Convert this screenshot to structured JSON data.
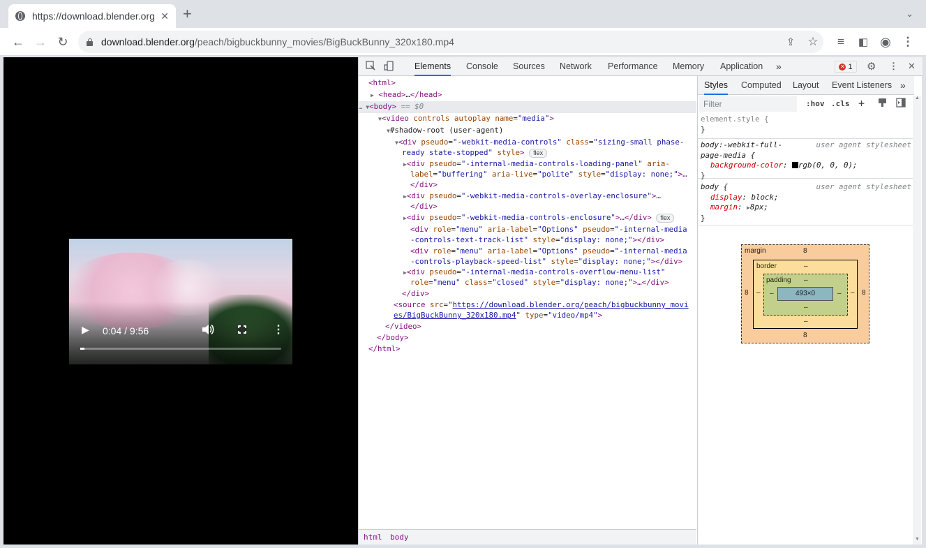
{
  "browser": {
    "tab_title": "https://download.blender.org/peach/bigbuckbunny_movies/BigBuckBunny_320x180.mp4",
    "url_domain": "download.blender.org",
    "url_path": "/peach/bigbuckbunny_movies/BigBuckBunny_320x180.mp4",
    "new_tab_glyph": "+",
    "close_glyph": "✕",
    "back_glyph": "←",
    "forward_glyph": "→",
    "reload_glyph": "↻",
    "tab_search_glyph": "⌄",
    "lock_glyph": "🔒",
    "share_glyph": "⇪",
    "star_glyph": "☆",
    "reading_list_glyph": "≡",
    "sidepanel_glyph": "◧",
    "profile_glyph": "◉",
    "menu_glyph": "⋮"
  },
  "video": {
    "play_glyph": "▶",
    "time": "0:04 / 9:56",
    "volume_glyph": "🔊",
    "more_glyph": "⋮",
    "progress": 0.022
  },
  "devtools": {
    "tabs": [
      "Elements",
      "Console",
      "Sources",
      "Network",
      "Performance",
      "Memory",
      "Application"
    ],
    "more_tabs_glyph": "»",
    "error_count": "1",
    "error_glyph": "✕",
    "inspect_glyph": "⬚",
    "device_glyph": "▯",
    "settings_glyph": "⚙",
    "kebab_glyph": "⋮",
    "close_glyph": "✕",
    "flex_badge": "flex",
    "dom": {
      "l1": "<html>",
      "l2_open": "<head>",
      "l2_dots": "…",
      "l2_close": "</head>",
      "l3_dots": "…",
      "l3_tag": "<body>",
      "l3_eq": " == $0",
      "l4_tag": "<video ",
      "l4_attrs": "controls autoplay name",
      "l4_eq": "=",
      "l4_val": "\"media\"",
      "l4_end": ">",
      "l5": "#shadow-root (user-agent)",
      "l6_tag": "<div ",
      "l6_an1": "pseudo",
      "l6_av1": "\"-webkit-media-controls\"",
      "l6_an2": " class",
      "l6_av2a": "\"sizing-small phase-",
      "l6_av2b": "ready state-stopped\"",
      "l6_an3": " style",
      "l7_tag": "<div ",
      "l7_an1": "pseudo",
      "l7_av1": "\"-internal-media-controls-loading-panel\"",
      "l7_an2": " aria-",
      "l7_an2b": "label",
      "l7_av2": "\"buffering\"",
      "l7_an3": " aria-live",
      "l7_av3": "\"polite\"",
      "l7_an4": " style",
      "l7_av4": "\"display: none;\"",
      "l7_end": ">…",
      "close_div": "</div>",
      "l8_tag": "<div ",
      "l8_an": "pseudo",
      "l8_av": "\"-webkit-media-controls-overlay-enclosure\"",
      "l8_end": ">…",
      "l9_tag": "<div ",
      "l9_an": "pseudo",
      "l9_av": "\"-webkit-media-controls-enclosure\"",
      "l9_end": ">…</div>",
      "l10_tag": "<div ",
      "l10_an1": "role",
      "l10_av1": "\"menu\"",
      "l10_an2": " aria-label",
      "l10_av2": "\"Options\"",
      "l10_an3": " pseudo",
      "l10_av3a": "\"-internal-media",
      "l10_av3b": "-controls-text-track-list\"",
      "l10_an4": " style",
      "l10_av4": "\"display: none;\"",
      "l10_end": "></div>",
      "l11_av3b": "-controls-playback-speed-list\"",
      "l12_av": "\"-internal-media-controls-overflow-menu-list\"",
      "l12_an2": " class",
      "l12_av2": "\"closed\"",
      "l12_end": ">…</div>",
      "l13_tag": "<source ",
      "l13_an": "src",
      "l13_eq": "=\"",
      "l13_link_a": "https://download.blender.org/peach/bigbuckbunny_movi",
      "l13_link_b": "es/BigBuckBunny_320x180.mp4",
      "l13_q": "\"",
      "l13_an2": " type",
      "l13_av2": "\"video/mp4\"",
      "l13_end": ">",
      "l14": "</video>",
      "l15": "</body>",
      "l16": "</html>"
    },
    "breadcrumbs": [
      "html",
      "body"
    ],
    "styles": {
      "tabs": [
        "Styles",
        "Computed",
        "Layout",
        "Event Listeners"
      ],
      "more_glyph": "»",
      "filter_placeholder": "Filter",
      "hov": ":hov",
      "cls": ".cls",
      "plus": "+",
      "rule1_selector": "element.style {",
      "rule_close": "}",
      "rule2_selector_a": "body:-webkit-full-",
      "rule2_selector_b": "page-media {",
      "rule2_source": "user agent stylesheet",
      "rule2_prop": "background-color",
      "rule2_val": "rgb(0, 0, 0);",
      "rule3_selector": "body {",
      "rule3_source": "user agent stylesheet",
      "rule3_prop1": "display",
      "rule3_val1": "block;",
      "rule3_prop2": "margin",
      "rule3_val2": "8px;",
      "box_margin_label": "margin",
      "box_border_label": "border",
      "box_padding_label": "padding",
      "margin_value": "8",
      "border_value": "–",
      "padding_value": "–",
      "content_size": "493×0"
    }
  }
}
